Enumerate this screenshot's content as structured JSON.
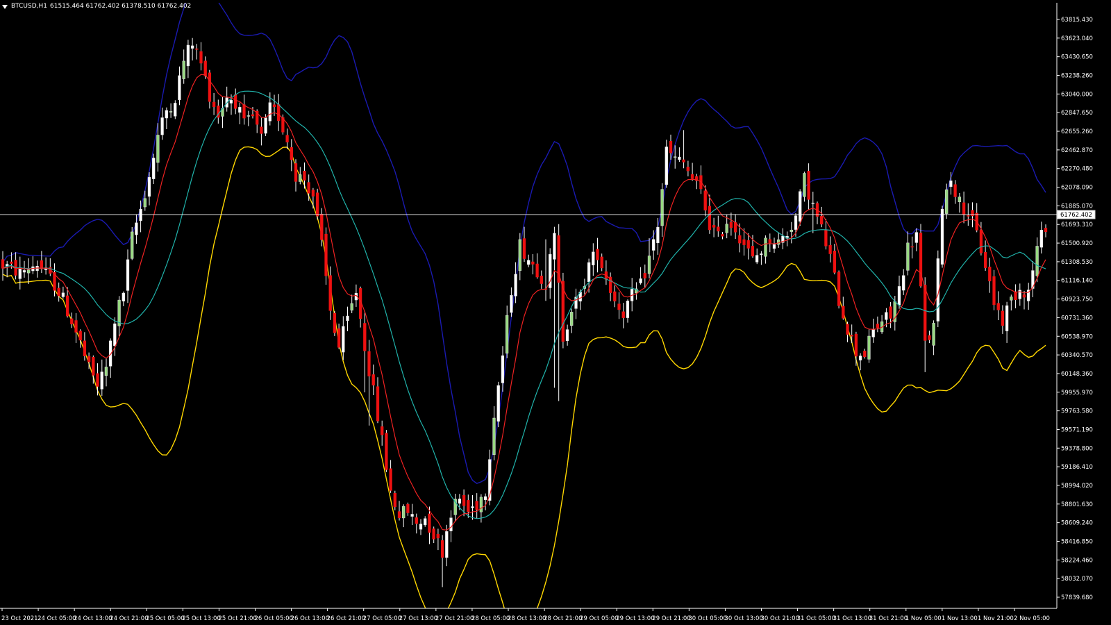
{
  "header": {
    "symbol": "BTCUSD,H1",
    "ohlc": "61515.464 61762.402 61378.510 61762.402"
  },
  "chart_data": {
    "type": "candlestick",
    "symbol": "BTCUSD",
    "timeframe": "H1",
    "current_price": "61762.402",
    "y_ticks": [
      "63815.430",
      "63623.040",
      "63430.650",
      "63238.260",
      "63040.000",
      "62847.650",
      "62655.260",
      "62462.870",
      "62270.480",
      "62078.090",
      "61885.070",
      "61693.310",
      "61500.920",
      "61308.530",
      "61116.140",
      "60923.750",
      "60731.360",
      "60538.970",
      "60340.570",
      "60148.360",
      "59955.970",
      "59763.580",
      "59571.190",
      "59378.800",
      "59186.410",
      "58994.020",
      "58801.630",
      "58609.240",
      "58416.850",
      "58224.460",
      "58032.070",
      "57839.680"
    ],
    "x_ticks": [
      "23 Oct 2021",
      "24 Oct 05:00",
      "24 Oct 13:00",
      "24 Oct 21:00",
      "25 Oct 05:00",
      "25 Oct 13:00",
      "25 Oct 21:00",
      "26 Oct 05:00",
      "26 Oct 13:00",
      "26 Oct 21:00",
      "27 Oct 05:00",
      "27 Oct 13:00",
      "27 Oct 21:00",
      "28 Oct 05:00",
      "28 Oct 13:00",
      "28 Oct 21:00",
      "29 Oct 05:00",
      "29 Oct 13:00",
      "29 Oct 21:00",
      "30 Oct 05:00",
      "30 Oct 13:00",
      "30 Oct 21:00",
      "31 Oct 05:00",
      "31 Oct 13:00",
      "31 Oct 21:00",
      "1 Nov 05:00",
      "1 Nov 13:00",
      "1 Nov 21:00",
      "2 Nov 05:00"
    ],
    "y_range": [
      57780,
      63905
    ],
    "close_anchors": [
      [
        0,
        61250
      ],
      [
        4,
        61180
      ],
      [
        8,
        61270
      ],
      [
        12,
        61060
      ],
      [
        14,
        60900
      ],
      [
        16,
        60690
      ],
      [
        18,
        60460
      ],
      [
        20,
        60200
      ],
      [
        22,
        60040
      ],
      [
        24,
        60210
      ],
      [
        26,
        60700
      ],
      [
        28,
        60980
      ],
      [
        30,
        61530
      ],
      [
        32,
        61820
      ],
      [
        34,
        62150
      ],
      [
        36,
        62560
      ],
      [
        38,
        62820
      ],
      [
        40,
        62950
      ],
      [
        42,
        63320
      ],
      [
        44,
        63510
      ],
      [
        46,
        63290
      ],
      [
        48,
        62980
      ],
      [
        50,
        62770
      ],
      [
        52,
        62960
      ],
      [
        54,
        62910
      ],
      [
        56,
        62660
      ],
      [
        58,
        62740
      ],
      [
        60,
        62530
      ],
      [
        62,
        62830
      ],
      [
        64,
        62760
      ],
      [
        66,
        62520
      ],
      [
        68,
        62170
      ],
      [
        70,
        62120
      ],
      [
        72,
        61960
      ],
      [
        74,
        61440
      ],
      [
        76,
        60790
      ],
      [
        78,
        60420
      ],
      [
        80,
        60690
      ],
      [
        82,
        60990
      ],
      [
        84,
        60440
      ],
      [
        86,
        59960
      ],
      [
        88,
        59480
      ],
      [
        90,
        58960
      ],
      [
        92,
        58730
      ],
      [
        94,
        58760
      ],
      [
        96,
        58640
      ],
      [
        98,
        58700
      ],
      [
        100,
        58530
      ],
      [
        102,
        58360
      ],
      [
        104,
        58770
      ],
      [
        106,
        58880
      ],
      [
        108,
        58760
      ],
      [
        110,
        58840
      ],
      [
        112,
        58980
      ],
      [
        114,
        59750
      ],
      [
        116,
        60340
      ],
      [
        118,
        61010
      ],
      [
        120,
        61460
      ],
      [
        122,
        61320
      ],
      [
        124,
        61210
      ],
      [
        126,
        61070
      ],
      [
        128,
        61530
      ],
      [
        130,
        60530
      ],
      [
        132,
        60820
      ],
      [
        134,
        60930
      ],
      [
        136,
        61260
      ],
      [
        138,
        61380
      ],
      [
        140,
        61130
      ],
      [
        142,
        60900
      ],
      [
        144,
        60780
      ],
      [
        146,
        60930
      ],
      [
        148,
        61040
      ],
      [
        150,
        61320
      ],
      [
        152,
        61660
      ],
      [
        154,
        62410
      ],
      [
        156,
        62320
      ],
      [
        158,
        62280
      ],
      [
        160,
        62120
      ],
      [
        162,
        61980
      ],
      [
        164,
        61670
      ],
      [
        166,
        61520
      ],
      [
        168,
        61700
      ],
      [
        170,
        61630
      ],
      [
        172,
        61470
      ],
      [
        174,
        61300
      ],
      [
        176,
        61410
      ],
      [
        178,
        61530
      ],
      [
        180,
        61480
      ],
      [
        182,
        61580
      ],
      [
        184,
        61740
      ],
      [
        186,
        62120
      ],
      [
        188,
        61850
      ],
      [
        190,
        61610
      ],
      [
        192,
        61330
      ],
      [
        194,
        60900
      ],
      [
        196,
        60620
      ],
      [
        198,
        60370
      ],
      [
        200,
        60360
      ],
      [
        202,
        60580
      ],
      [
        204,
        60690
      ],
      [
        206,
        60730
      ],
      [
        208,
        61010
      ],
      [
        210,
        61430
      ],
      [
        212,
        61560
      ],
      [
        214,
        60440
      ],
      [
        216,
        60620
      ],
      [
        218,
        61880
      ],
      [
        220,
        62140
      ],
      [
        222,
        61880
      ],
      [
        224,
        61790
      ],
      [
        226,
        61560
      ],
      [
        228,
        61260
      ],
      [
        230,
        60880
      ],
      [
        232,
        60690
      ],
      [
        234,
        60910
      ],
      [
        236,
        61020
      ],
      [
        238,
        60980
      ],
      [
        240,
        61420
      ],
      [
        242,
        61660
      ]
    ]
  },
  "colors": {
    "background": "#000000",
    "bull_candle": "#ffffff",
    "bull_candle_alt": "#98d982",
    "bear_candle": "#ee1111",
    "wick": "#ffffff",
    "ma_fast": "#ee2222",
    "ma_slow": "#20b2aa",
    "band_upper": "#1a1ab0",
    "band_lower": "#ffd700",
    "price_line": "#ffffff",
    "axis_text": "#ffffff"
  }
}
